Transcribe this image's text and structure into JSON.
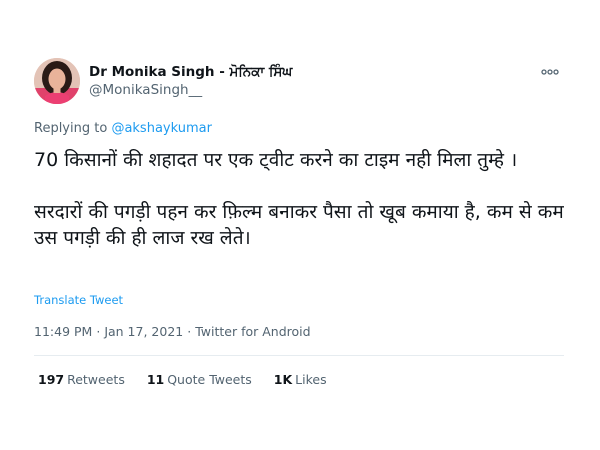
{
  "author": {
    "display_name": "Dr Monika Singh - ਮੋਨਿਕਾ ਸਿੰਘ",
    "handle": "@MonikaSingh__"
  },
  "reply": {
    "prefix": "Replying to",
    "mention": "@akshaykumar"
  },
  "tweet": {
    "paragraph_1": "70 किसानों की शहादत पर एक ट्वीट करने का टाइम नही मिला तुम्हे ।",
    "paragraph_2": "सरदारों की पगड़ी पहन कर फ़िल्म बनाकर पैसा तो खूब कमाया है, कम से कम उस पगड़ी की ही लाज रख लेते।",
    "translate_label": "Translate Tweet"
  },
  "meta": {
    "time": "11:49 PM",
    "date": "Jan 17, 2021",
    "source": "Twitter for Android",
    "separator": "·"
  },
  "stats": {
    "retweets_count": "197",
    "retweets_label": "Retweets",
    "quotes_count": "11",
    "quotes_label": "Quote Tweets",
    "likes_count": "1K",
    "likes_label": "Likes"
  },
  "colors": {
    "link": "#1d9bf0",
    "secondary_text": "#536471",
    "primary_text": "#0f1419",
    "divider": "#e6ecf0"
  },
  "icons": {
    "more": "more-horizontal-icon"
  }
}
